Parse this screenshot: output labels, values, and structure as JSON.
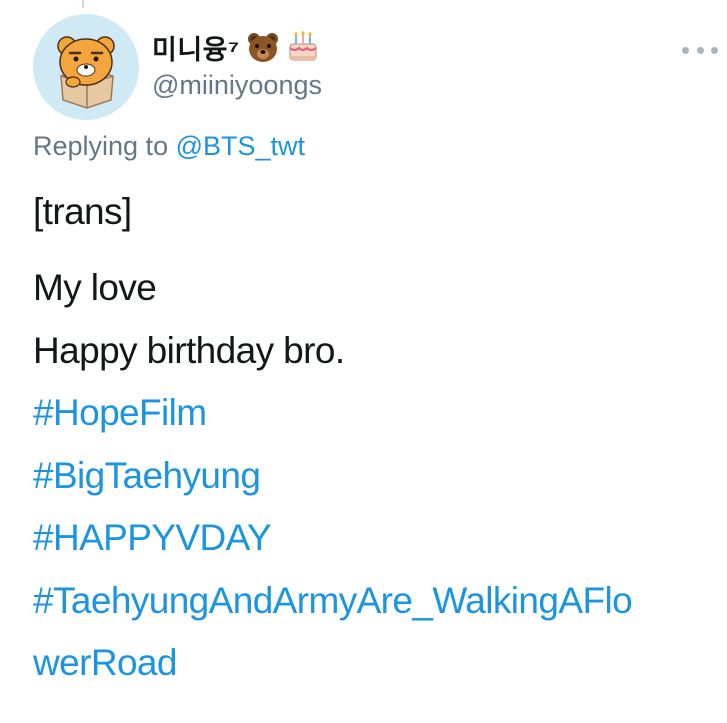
{
  "user": {
    "display_name": "미니융⁷",
    "handle": "@miiniyoongs",
    "name_emojis": [
      "bear-face-emoji",
      "birthday-cake-emoji"
    ],
    "avatar": "ryan-character-avatar"
  },
  "reply": {
    "prefix": "Replying to",
    "to_handle": "@BTS_twt"
  },
  "tweet": {
    "lines": [
      "[trans]",
      "My love",
      "Happy birthday bro."
    ],
    "hashtags": [
      "#HopeFilm",
      "#BigTaehyung",
      "#HAPPYVDAY",
      "#TaehyungAndArmyAre_WalkingAFlo",
      "werRoad"
    ]
  },
  "colors": {
    "link": "#1b95e0",
    "secondary_text": "#657786",
    "primary_text": "#14171a",
    "avatar_bg": "#cfe9f5"
  },
  "icons": {
    "more": "more-options-icon"
  }
}
